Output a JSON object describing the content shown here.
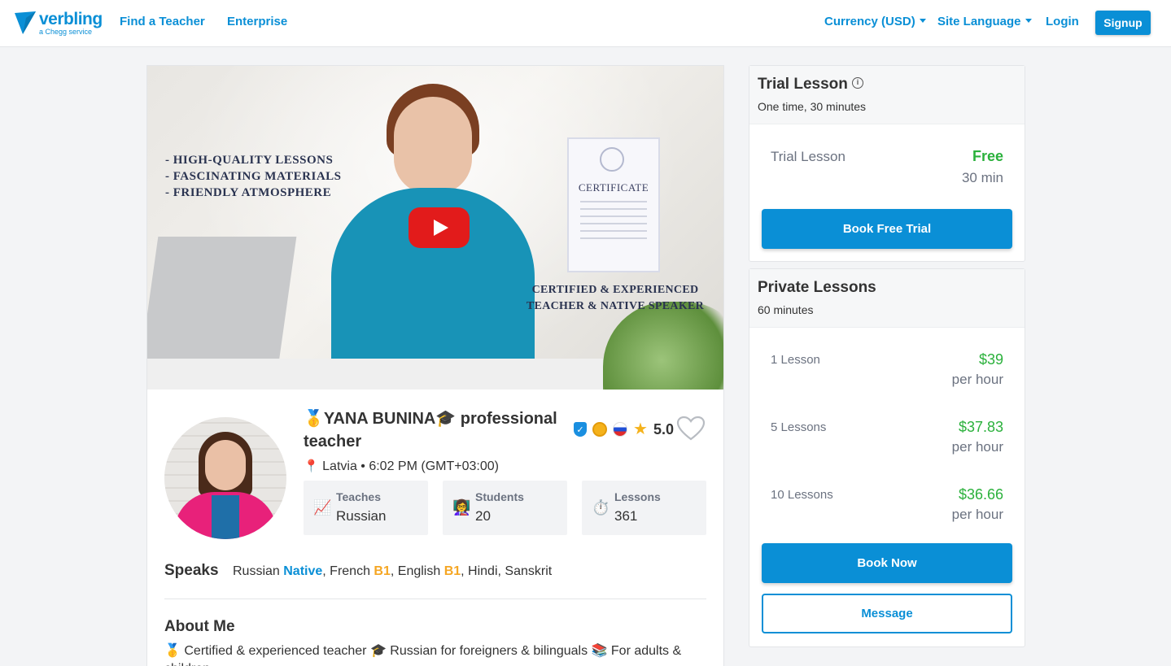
{
  "header": {
    "logo_word": "verbling",
    "logo_sub": "a Chegg service",
    "nav": {
      "find_teacher": "Find a Teacher",
      "enterprise": "Enterprise"
    },
    "currency": "Currency (USD)",
    "site_language": "Site Language",
    "login": "Login",
    "signup": "Signup"
  },
  "video": {
    "bullets": [
      "- HIGH-QUALITY LESSONS",
      "- FASCINATING MATERIALS",
      "- FRIENDLY ATMOSPHERE"
    ],
    "certificate_title": "CERTIFICATE",
    "caption_line1": "CERTIFIED & EXPERIENCED",
    "caption_line2": "TEACHER & NATIVE SPEAKER"
  },
  "profile": {
    "name": "🥇YANA BUNINA🎓 professional teacher",
    "rating": "5.0",
    "location_pin": "📍",
    "location": "Latvia • 6:02 PM (GMT+03:00)",
    "stats": [
      {
        "icon": "📈",
        "label": "Teaches",
        "value": "Russian"
      },
      {
        "icon": "👩‍🏫",
        "label": "Students",
        "value": "20"
      },
      {
        "icon": "⏱️",
        "label": "Lessons",
        "value": "361"
      }
    ],
    "speaks_label": "Speaks",
    "languages": [
      {
        "name": "Russian",
        "level": "Native",
        "sep": ", "
      },
      {
        "name": "French",
        "level": "B1",
        "sep": ", "
      },
      {
        "name": "English",
        "level": "B1",
        "sep": ", "
      },
      {
        "name": "Hindi",
        "level": "",
        "sep": ", "
      },
      {
        "name": "Sanskrit",
        "level": "",
        "sep": ""
      }
    ],
    "about_title": "About Me",
    "about_text": "🥇 Certified & experienced teacher 🎓 Russian for foreigners & bilinguals 📚 For adults & children"
  },
  "trial": {
    "title": "Trial Lesson",
    "subtitle": "One time, 30 minutes",
    "row_label": "Trial Lesson",
    "price": "Free",
    "duration": "30 min",
    "button": "Book Free Trial"
  },
  "private": {
    "title": "Private Lessons",
    "subtitle": "60 minutes",
    "rows": [
      {
        "label": "1 Lesson",
        "price": "$39",
        "unit": "per hour"
      },
      {
        "label": "5 Lessons",
        "price": "$37.83",
        "unit": "per hour"
      },
      {
        "label": "10 Lessons",
        "price": "$36.66",
        "unit": "per hour"
      }
    ],
    "book_button": "Book Now",
    "message_button": "Message"
  },
  "colors": {
    "accent": "#0a8fd6",
    "price_green": "#2bb13c",
    "level_orange": "#f5a623"
  }
}
